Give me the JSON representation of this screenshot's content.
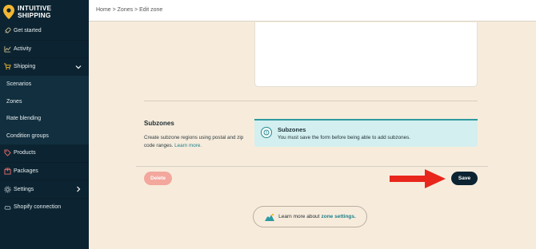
{
  "brand": {
    "line1": "INTUITIVE",
    "line2": "SHIPPING"
  },
  "sidebar": {
    "items": [
      {
        "label": "Get started",
        "icon": "rocket-icon"
      },
      {
        "label": "Activity",
        "icon": "chart-icon"
      },
      {
        "label": "Shipping",
        "icon": "cart-icon",
        "expanded": true
      },
      {
        "label": "Scenarios"
      },
      {
        "label": "Zones"
      },
      {
        "label": "Rate blending"
      },
      {
        "label": "Condition groups"
      },
      {
        "label": "Products",
        "icon": "tag-icon"
      },
      {
        "label": "Packages",
        "icon": "package-icon"
      },
      {
        "label": "Settings",
        "icon": "gear-icon"
      },
      {
        "label": "Shopify connection",
        "icon": "cloud-icon"
      }
    ]
  },
  "breadcrumb": "Home > Zones > Edit zone",
  "subzones": {
    "title": "Subzones",
    "description": "Create subzone regions using postal and zip code ranges.",
    "link": "Learn more.",
    "info_title": "Subzones",
    "info_message": "You must save the form before being able to add subzones."
  },
  "actions": {
    "delete": "Delete",
    "save": "Save"
  },
  "learn_more": {
    "prefix": "Learn more about",
    "link": "zone settings."
  },
  "colors": {
    "sidebar": "#0c2431",
    "accent": "#1e7f8a",
    "info_bg": "#d4efef",
    "delete": "#f3a79d",
    "arrow": "#e8261c",
    "page_bg": "#f7ecdc"
  }
}
